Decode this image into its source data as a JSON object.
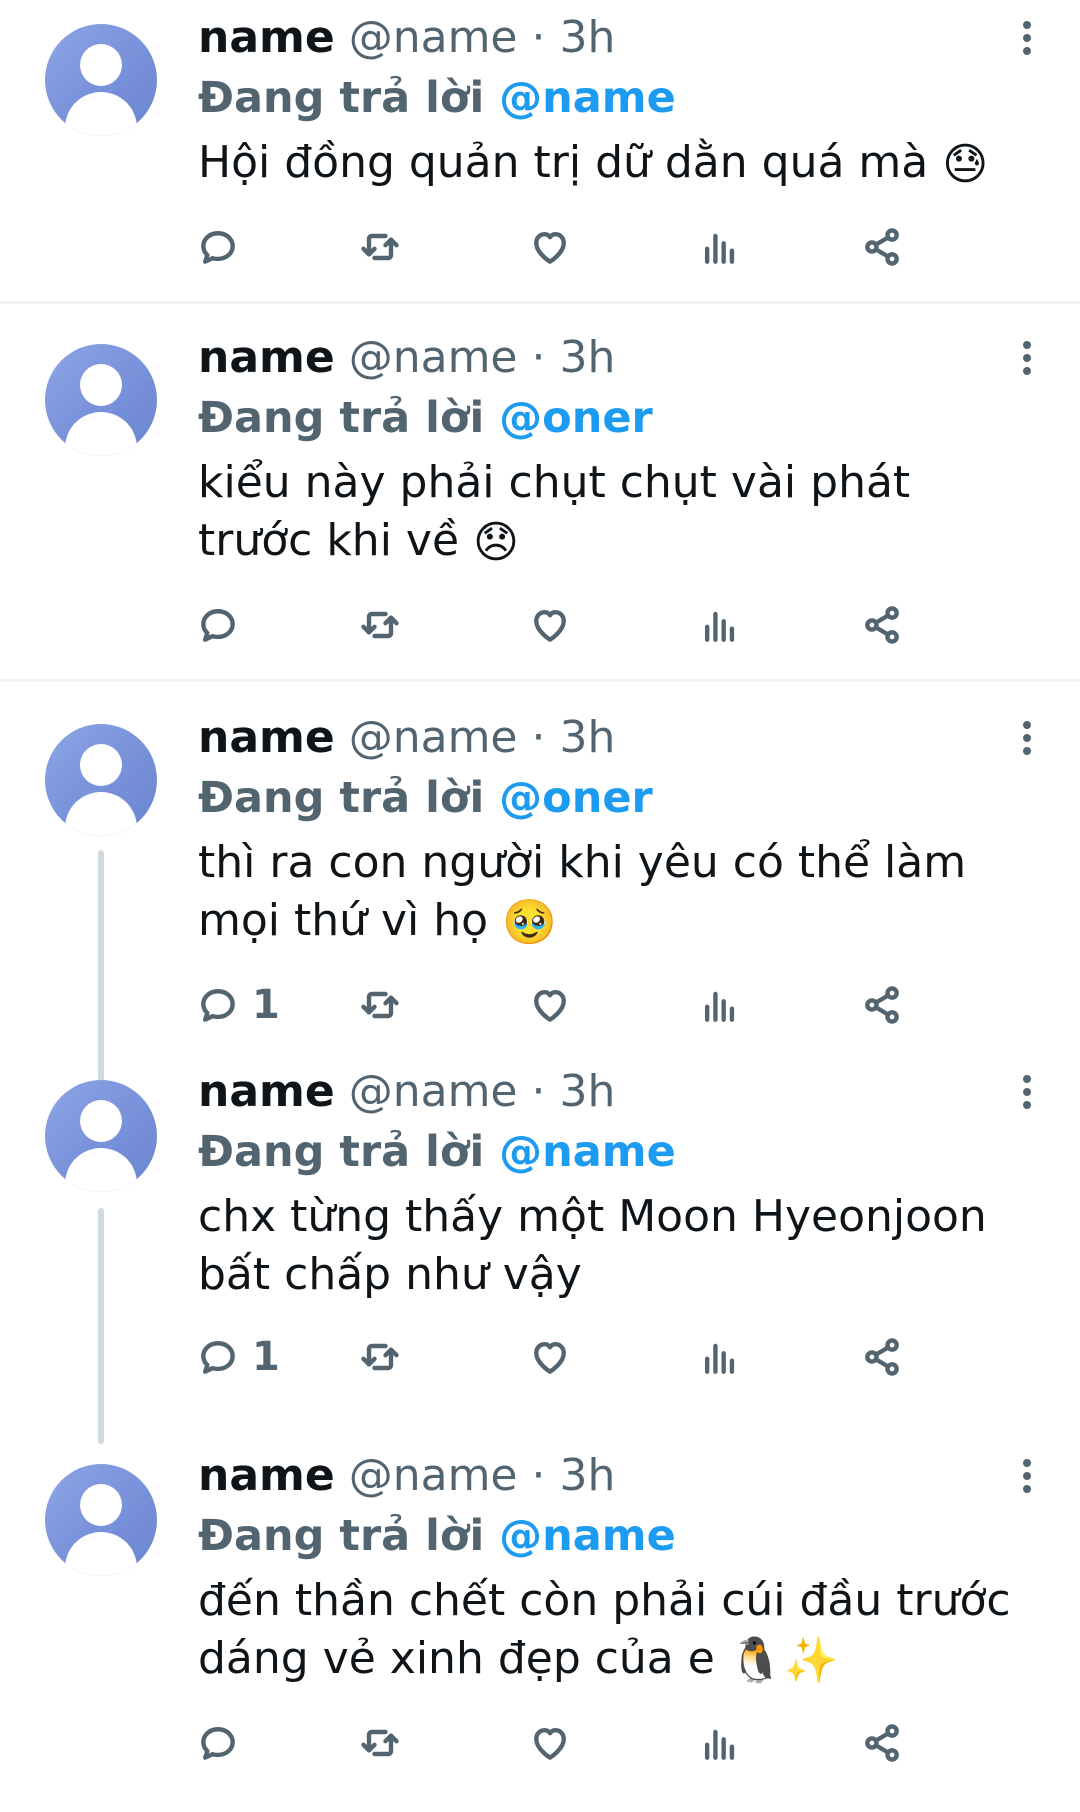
{
  "tweets": [
    {
      "display_name": "name",
      "handle": "@name",
      "separator": "·",
      "time": "3h",
      "replying_label": "Đang trả lời",
      "replying_to": "@name",
      "text": "Hội đồng quản trị dữ dằn quá mà",
      "emoji": "😓",
      "reply_count": ""
    },
    {
      "display_name": "name",
      "handle": "@name",
      "separator": "·",
      "time": "3h",
      "replying_label": "Đang trả lời",
      "replying_to": "@oner",
      "text": "kiểu này phải chụt chụt vài phát\ntrước khi về",
      "emoji": "😞",
      "reply_count": ""
    },
    {
      "display_name": "name",
      "handle": "@name",
      "separator": "·",
      "time": "3h",
      "replying_label": "Đang trả lời",
      "replying_to": "@oner",
      "text": "thì ra con người khi yêu có thể làm\nmọi thứ vì họ",
      "emoji": "🥹",
      "reply_count": "1"
    },
    {
      "display_name": "name",
      "handle": "@name",
      "separator": "·",
      "time": "3h",
      "replying_label": "Đang trả lời",
      "replying_to": "@name",
      "text": "chx từng thấy một Moon Hyeonjoon\nbất chấp như vậy",
      "emoji": "",
      "reply_count": "1"
    },
    {
      "display_name": "name",
      "handle": "@name",
      "separator": "·",
      "time": "3h",
      "replying_label": "Đang trả lời",
      "replying_to": "@name",
      "text": "đến thần chết còn phải cúi đầu trước\ndáng vẻ xinh đẹp của e",
      "emoji": "🐧✨",
      "reply_count": ""
    }
  ],
  "icons": {
    "reply": "reply-icon",
    "retweet": "retweet-icon",
    "like": "heart-icon",
    "views": "views-icon",
    "share": "share-icon",
    "more": "more-vertical-icon",
    "avatar": "default-avatar-icon"
  },
  "colors": {
    "accent": "#1d9bf0",
    "muted": "#536471",
    "text": "#0f1419",
    "divider": "#eff3f4",
    "avatar": "#7b94dc"
  }
}
